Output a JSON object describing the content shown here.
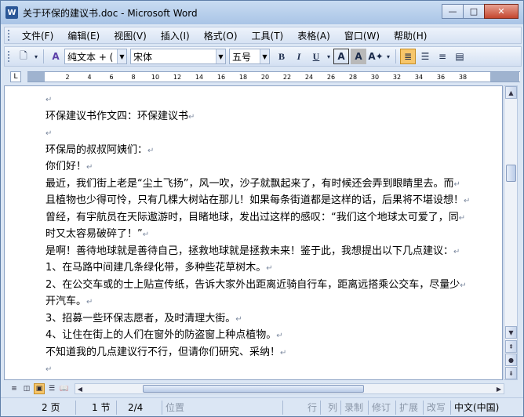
{
  "window": {
    "title": "关于环保的建议书.doc - Microsoft Word",
    "app_icon_letter": "W",
    "buttons": {
      "minimize": "—",
      "maximize": "□",
      "close": "✕"
    }
  },
  "menu": [
    "文件(F)",
    "编辑(E)",
    "视图(V)",
    "插入(I)",
    "格式(O)",
    "工具(T)",
    "表格(A)",
    "窗口(W)",
    "帮助(H)"
  ],
  "toolbar": {
    "style_value": "纯文本 + (",
    "font_value": "宋体",
    "size_value": "五号",
    "bold": "B",
    "italic": "I",
    "underline": "U"
  },
  "ruler": {
    "corner": "L",
    "ticks": [
      "2",
      "4",
      "6",
      "8",
      "10",
      "12",
      "14",
      "16",
      "18",
      "20",
      "22",
      "24",
      "26",
      "28",
      "30",
      "32",
      "34",
      "36",
      "38"
    ]
  },
  "document": {
    "lines": [
      "",
      "环保建议书作文四：环保建议书",
      "",
      "环保局的叔叔阿姨们：",
      "你们好！",
      "最近，我们街上老是“尘土飞扬”，风一吹，沙子就飘起来了，有时候还会弄到眼睛里去。而",
      "且植物也少得可怜，只有几棵大树站在那儿！如果每条街道都是这样的话，后果将不堪设想！",
      "曾经，有宇航员在天际遨游时，目睹地球，发出过这样的感叹：“我们这个地球太可爱了，同",
      "时又太容易破碎了！”",
      "是啊！善待地球就是善待自己，拯救地球就是拯救未来！鉴于此，我想提出以下几点建议：",
      "1、在马路中间建几条绿化带，多种些花草树木。",
      "2、在公交车或的士上贴宣传纸，告诉大家外出距离近骑自行车，距离远搭乘公交车，尽量少",
      "开汽车。",
      "3、招募一些环保志愿者，及时清理大街。",
      "4、让住在街上的人们在窗外的防盗窗上种点植物。",
      "不知道我的几点建议行不行，但请你们研究、采纳！",
      "",
      ""
    ],
    "paragraph_mark": "↵"
  },
  "status": {
    "page": "2 页",
    "section": "1 节",
    "page_of": "2/4",
    "position": "位置",
    "row": "行",
    "col": "列",
    "rec": "录制",
    "trk": "修订",
    "ext": "扩展",
    "ovr": "改写",
    "lang": "中文(中国)"
  }
}
